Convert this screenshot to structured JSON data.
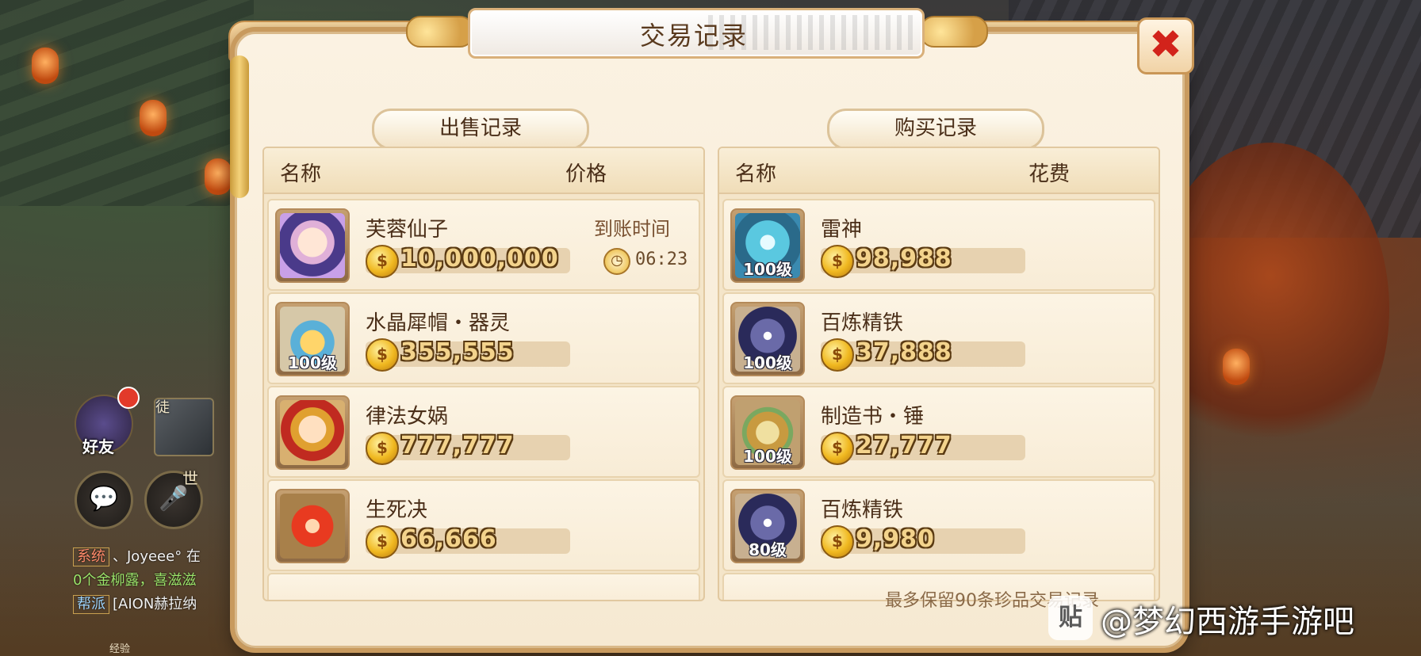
{
  "hud": {
    "friends_label": "好友",
    "apprentice_label": "徒",
    "world_label": "世",
    "chat_icon": "chat-bubble-icon",
    "voice_icon": "microphone-icon",
    "chat_lines": [
      {
        "tag": "系统",
        "text": "、Joyeee° 在"
      },
      {
        "tag": "",
        "text": "0个金柳露，喜滋滋"
      },
      {
        "tag": "帮派",
        "text": "[AION赫拉纳"
      }
    ],
    "exp_label": "经验"
  },
  "dialog": {
    "title": "交易记录",
    "close_label": "✖",
    "footer_note": "最多保留90条珍品交易记录"
  },
  "sell_panel": {
    "tab_label": "出售记录",
    "col_name": "名称",
    "col_price": "价格",
    "arrive_label": "到账时间",
    "items": [
      {
        "name": "芙蓉仙子",
        "price": "10,000,000",
        "level": "",
        "art": "fairy",
        "arrive_time": "06:23"
      },
      {
        "name": "水晶犀帽・器灵",
        "price": "355,555",
        "level": "100级",
        "art": "hat"
      },
      {
        "name": "律法女娲",
        "price": "777,777",
        "level": "",
        "art": "nuwa"
      },
      {
        "name": "生死决",
        "price": "66,666",
        "level": "",
        "art": "orb"
      }
    ]
  },
  "buy_panel": {
    "tab_label": "购买记录",
    "col_name": "名称",
    "col_price": "花费",
    "items": [
      {
        "name": "雷神",
        "price": "98,988",
        "level": "100级",
        "art": "thunder"
      },
      {
        "name": "百炼精铁",
        "price": "37,888",
        "level": "100级",
        "art": "iron"
      },
      {
        "name": "制造书・锤",
        "price": "27,777",
        "level": "100级",
        "art": "book"
      },
      {
        "name": "百炼精铁",
        "price": "9,980",
        "level": "80级",
        "art": "iron"
      }
    ]
  },
  "watermark": {
    "badge": "贴",
    "text": "@梦幻西游手游吧"
  },
  "colors": {
    "title_brown": "#5a3a1e",
    "close_red": "#d2231b",
    "price_gold": "#f3d38c"
  }
}
